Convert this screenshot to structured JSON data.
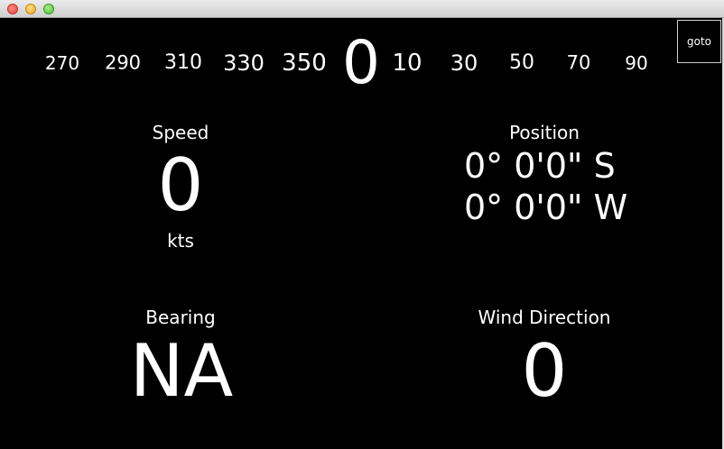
{
  "goto_button": {
    "label": "goto"
  },
  "compass": {
    "ticks": [
      "270",
      "290",
      "310",
      "330",
      "350",
      "0",
      "10",
      "30",
      "50",
      "70",
      "90"
    ],
    "current_heading": "0"
  },
  "speed": {
    "title": "Speed",
    "value": "0",
    "unit": "kts"
  },
  "position": {
    "title": "Position",
    "lat": "0° 0'0\" S",
    "lon": "0° 0'0\" W"
  },
  "bearing": {
    "title": "Bearing",
    "value": "NA"
  },
  "wind": {
    "title": "Wind Direction",
    "value": "0"
  }
}
